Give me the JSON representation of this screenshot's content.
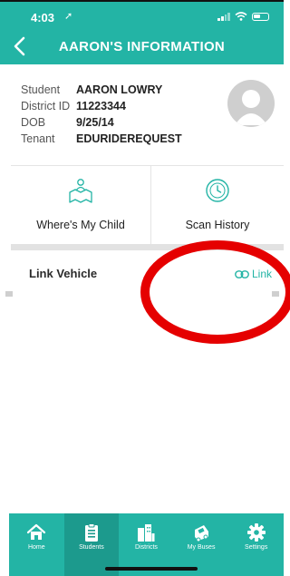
{
  "status_bar": {
    "time": "4:03",
    "location_arrow": "➚"
  },
  "header": {
    "title": "AARON'S INFORMATION",
    "back_icon": "chevron-left-icon"
  },
  "student_info": [
    {
      "label": "Student",
      "value": "AARON LOWRY"
    },
    {
      "label": "District ID",
      "value": "11223344"
    },
    {
      "label": "DOB",
      "value": "9/25/14"
    },
    {
      "label": "Tenant",
      "value": "EDURIDEREQUEST"
    }
  ],
  "actions": {
    "wheres_my_child": "Where's My Child",
    "scan_history": "Scan History"
  },
  "link_vehicle": {
    "title": "Link Vehicle",
    "button": "Link"
  },
  "tabs": [
    {
      "label": "Home",
      "icon": "home-icon"
    },
    {
      "label": "Students",
      "icon": "clipboard-icon",
      "active": true
    },
    {
      "label": "Districts",
      "icon": "buildings-icon"
    },
    {
      "label": "My Buses",
      "icon": "bus-icon"
    },
    {
      "label": "Settings",
      "icon": "gear-icon"
    }
  ],
  "colors": {
    "primary": "#23b4a5",
    "primary_dark": "#1c9a8d",
    "annotation": "#e50000"
  }
}
